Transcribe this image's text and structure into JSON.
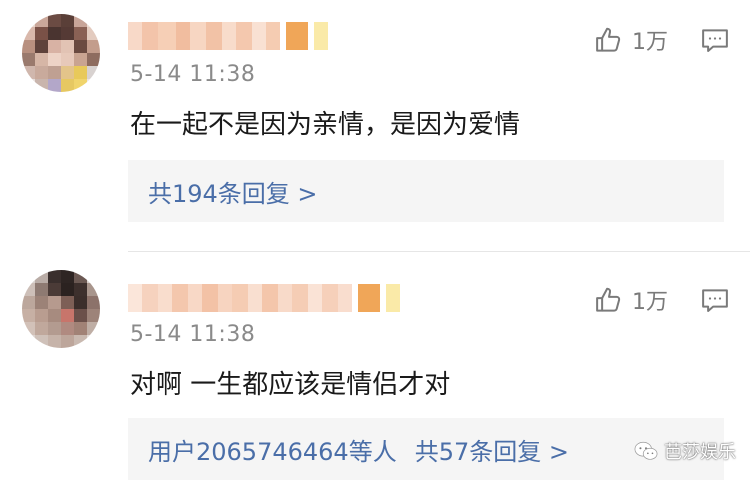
{
  "comments": [
    {
      "time": "5-14 11:38",
      "text": "在一起不是因为亲情，是因为爱情",
      "likes": "1万",
      "reply": {
        "prefix": "",
        "count_text": "共194条回复 >"
      }
    },
    {
      "time": "5-14 11:38",
      "text": "对啊 一生都应该是情侣才对",
      "likes": "1万",
      "reply": {
        "prefix": "用户2065746464等人",
        "count_text": "共57条回复 >"
      }
    }
  ],
  "watermark": {
    "text": "芭莎娱乐"
  },
  "icons": {
    "like": "thumbs-up-icon",
    "comment": "comment-bubble-icon",
    "watermark": "wechat-icon"
  },
  "colors": {
    "link": "#4a6ea8",
    "time": "#8a8a8a",
    "text": "#1a1a1a",
    "reply_bg": "#f5f5f5"
  }
}
